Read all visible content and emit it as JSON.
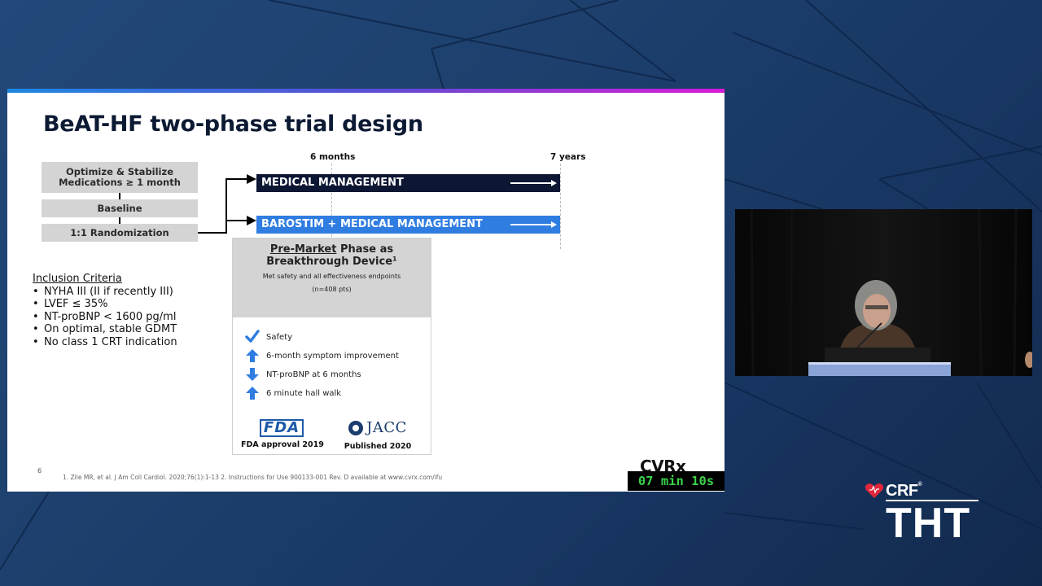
{
  "slide": {
    "title": "BeAT-HF two-phase trial design",
    "flow": {
      "step1": "Optimize & Stabilize\nMedications ≥ 1 month",
      "step2": "Baseline",
      "step3": "1:1 Randomization"
    },
    "timeline": {
      "label_6m": "6 months",
      "label_7y": "7 years",
      "arm1": "MEDICAL MANAGEMENT",
      "arm2": "BAROSTIM + MEDICAL MANAGEMENT"
    },
    "inclusion": {
      "heading": "Inclusion Criteria",
      "items": [
        "NYHA III (II if recently III)",
        "LVEF ≤ 35%",
        "NT-proBNP < 1600 pg/ml",
        "On optimal, stable GDMT",
        "No class 1 CRT indication"
      ]
    },
    "phase": {
      "title_underlined": "Pre-Market",
      "title_rest": " Phase as",
      "title_line2": "Breakthrough Device¹",
      "subtitle": "Met safety and all effectiveness endpoints",
      "n": "(n=408 pts)",
      "endpoints": [
        {
          "icon": "checkmark-icon",
          "label": "Safety"
        },
        {
          "icon": "arrow-up-icon",
          "label": "6-month symptom improvement"
        },
        {
          "icon": "arrow-down-icon",
          "label": "NT-proBNP at 6 months"
        },
        {
          "icon": "arrow-up-icon",
          "label": "6 minute hall walk"
        }
      ],
      "fda_logo_text": "FDA",
      "fda_caption": "FDA approval 2019",
      "jacc_logo_text": "JACC",
      "jacc_caption": "Published 2020"
    },
    "slide_number": "6",
    "references": "1. Zile MR, et al.  J Am Coll Cardiol. 2020;76(1):1-13 2. Instructions for Use 900133-001 Rev. D available at www.cvrx.com/ifu",
    "sponsor_logo": "CVRx"
  },
  "timer": "07 min 10s",
  "branding": {
    "crf": "CRF",
    "crf_mark": "®",
    "tht": "THT"
  },
  "colors": {
    "dark_bar": "#0d1633",
    "blue_bar": "#2f7de1",
    "timer_text": "#3ad14a",
    "crf_red": "#e0263b"
  }
}
